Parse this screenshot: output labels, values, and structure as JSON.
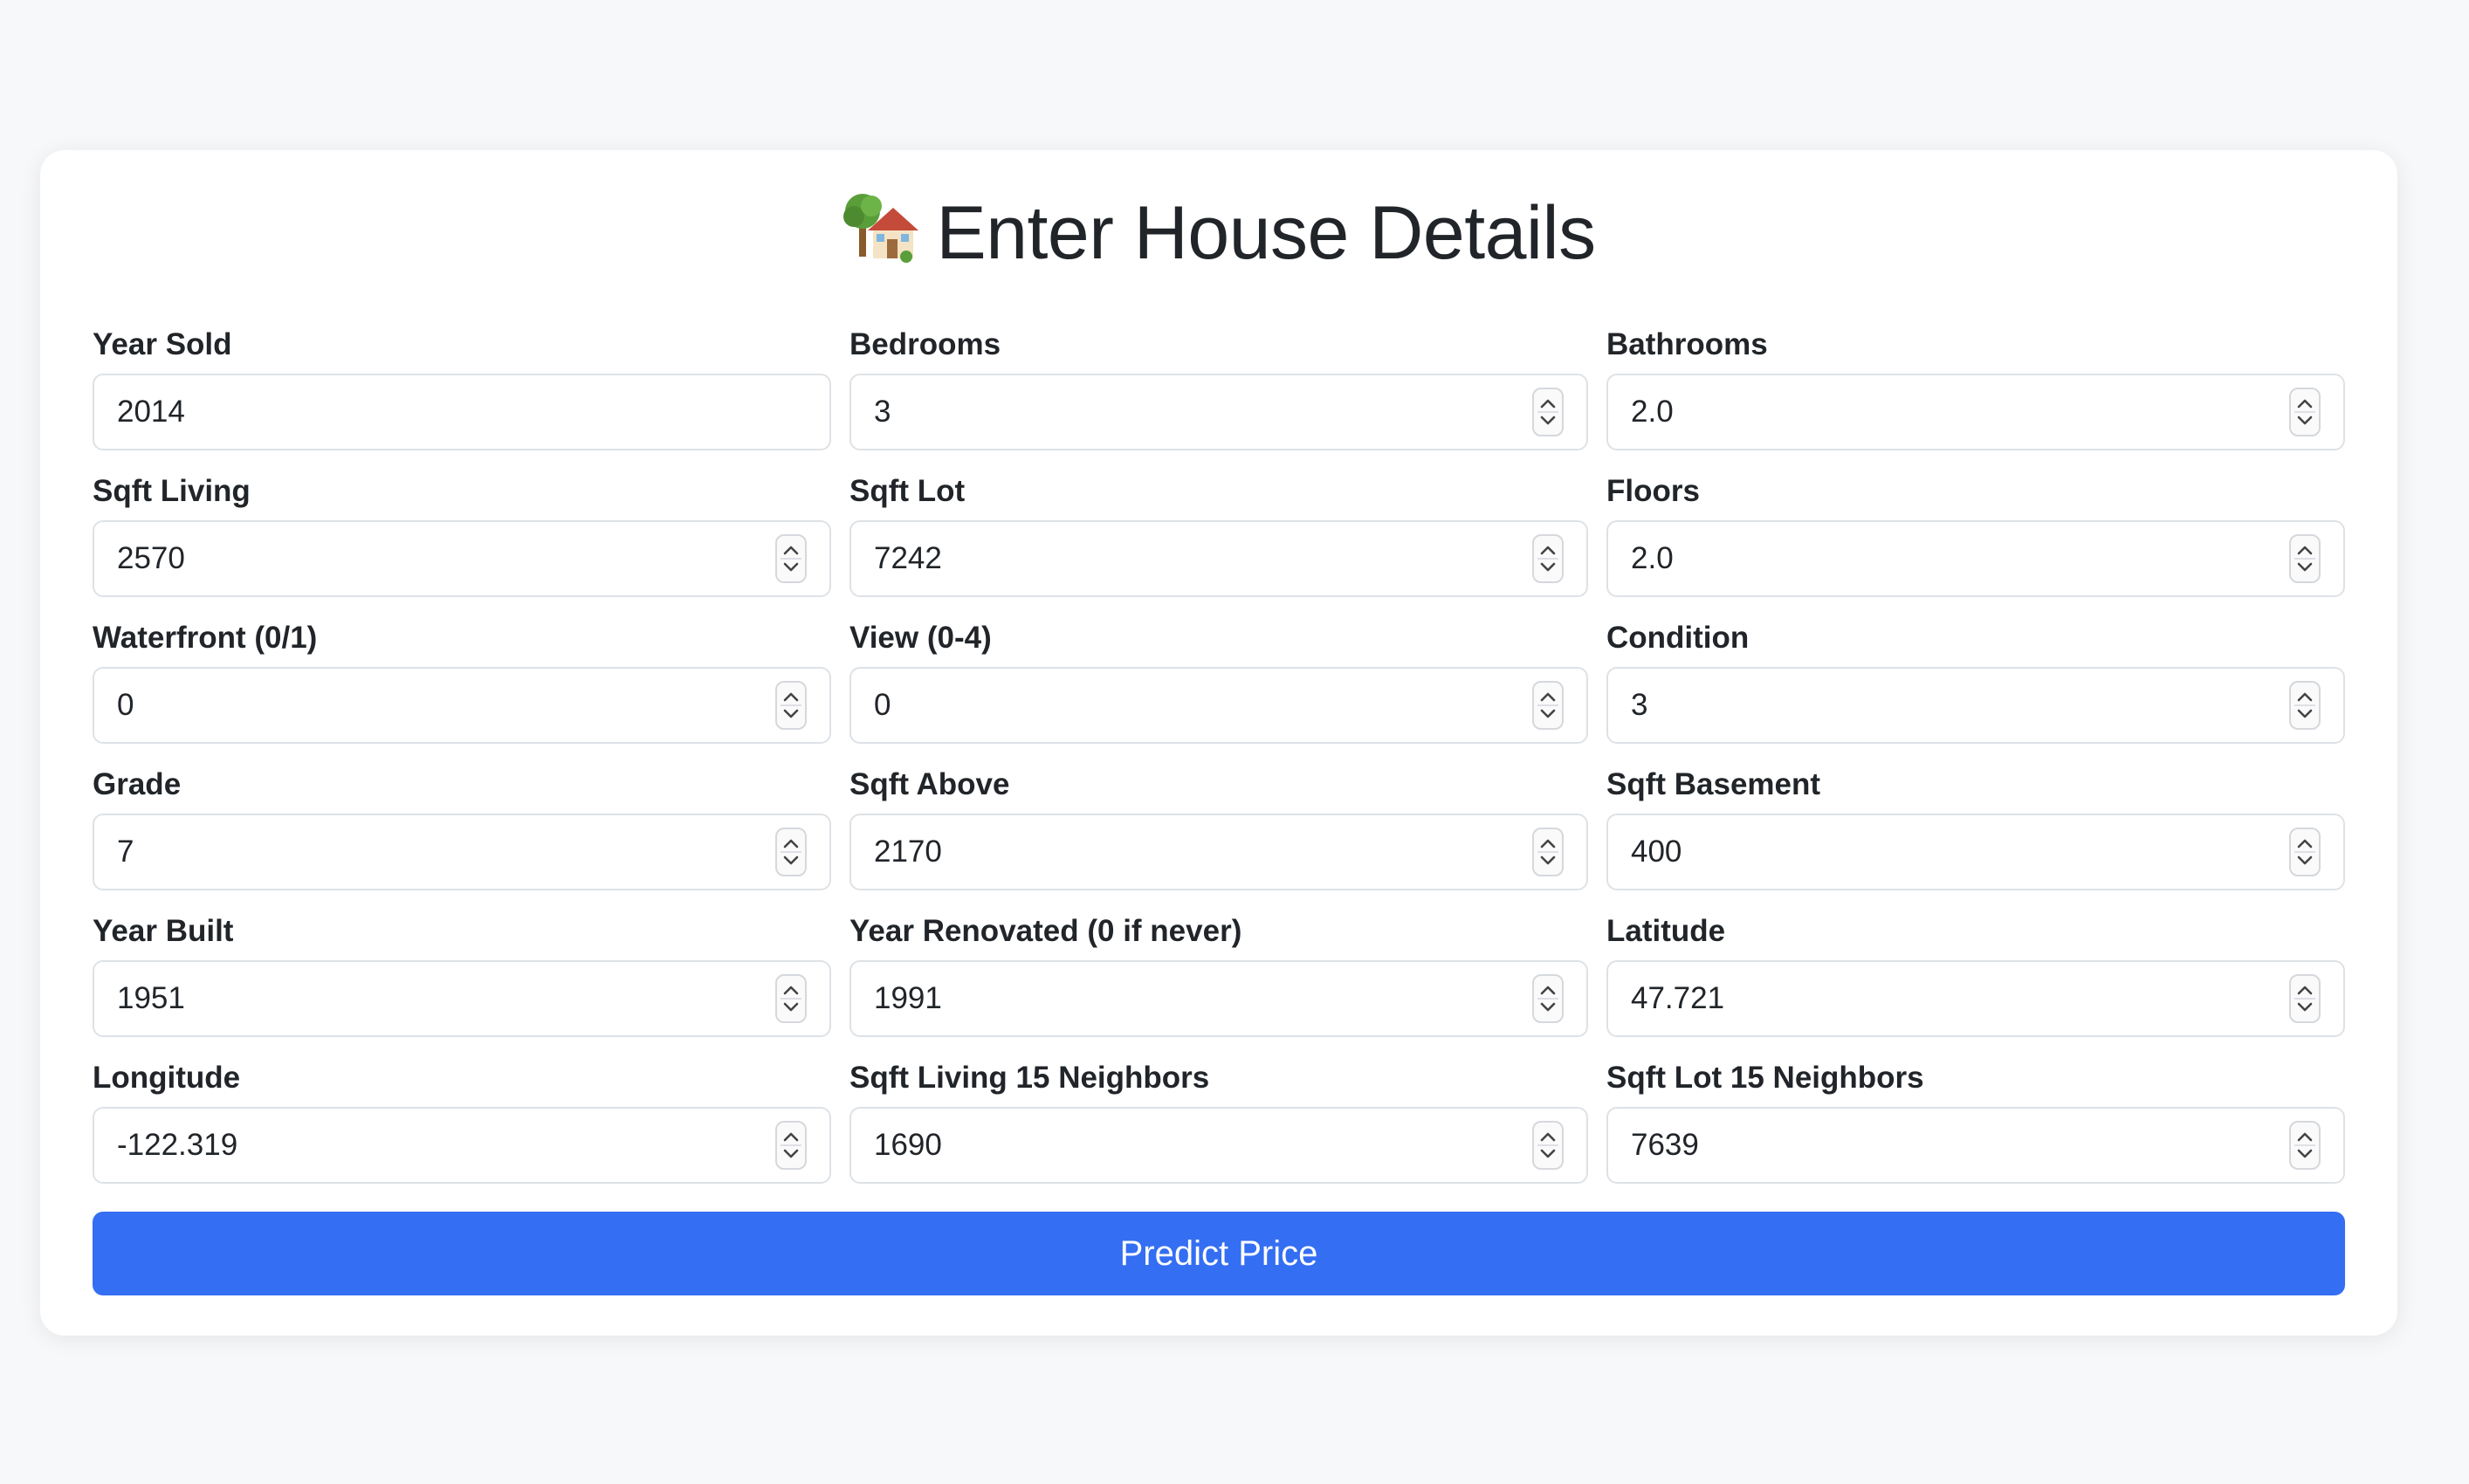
{
  "form": {
    "title": "Enter House Details",
    "title_icon": "house-with-tree-icon",
    "fields": [
      {
        "label": "Year Sold",
        "value": "2014",
        "spinner": false
      },
      {
        "label": "Bedrooms",
        "value": "3",
        "spinner": true
      },
      {
        "label": "Bathrooms",
        "value": "2.0",
        "spinner": true
      },
      {
        "label": "Sqft Living",
        "value": "2570",
        "spinner": true
      },
      {
        "label": "Sqft Lot",
        "value": "7242",
        "spinner": true
      },
      {
        "label": "Floors",
        "value": "2.0",
        "spinner": true
      },
      {
        "label": "Waterfront (0/1)",
        "value": "0",
        "spinner": true
      },
      {
        "label": "View (0-4)",
        "value": "0",
        "spinner": true
      },
      {
        "label": "Condition",
        "value": "3",
        "spinner": true
      },
      {
        "label": "Grade",
        "value": "7",
        "spinner": true
      },
      {
        "label": "Sqft Above",
        "value": "2170",
        "spinner": true
      },
      {
        "label": "Sqft Basement",
        "value": "400",
        "spinner": true
      },
      {
        "label": "Year Built",
        "value": "1951",
        "spinner": true
      },
      {
        "label": "Year Renovated (0 if never)",
        "value": "1991",
        "spinner": true
      },
      {
        "label": "Latitude",
        "value": "47.721",
        "spinner": true
      },
      {
        "label": "Longitude",
        "value": "-122.319",
        "spinner": true
      },
      {
        "label": "Sqft Living 15 Neighbors",
        "value": "1690",
        "spinner": true
      },
      {
        "label": "Sqft Lot 15 Neighbors",
        "value": "7639",
        "spinner": true
      }
    ],
    "submit_label": "Predict Price"
  },
  "colors": {
    "page_background": "#f7f8fa",
    "card_background": "#ffffff",
    "button": "#346ef2",
    "input_border": "#dee2e6",
    "text": "#212529"
  }
}
